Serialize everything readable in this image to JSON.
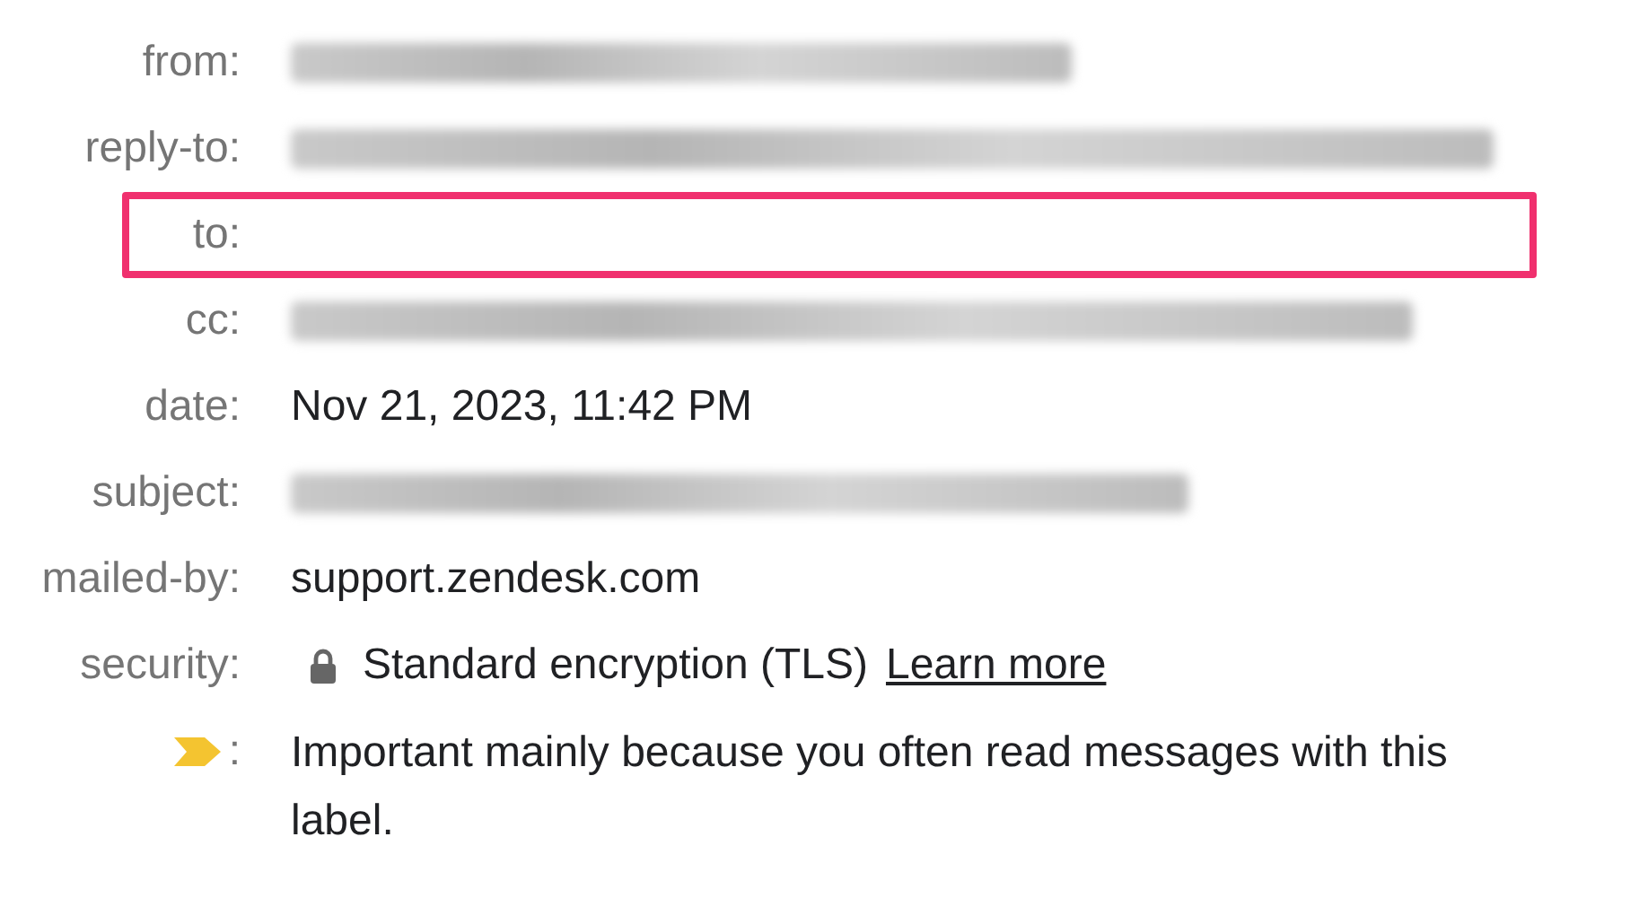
{
  "rows": [
    {
      "label": "from:",
      "kind": "blurred",
      "highlighted": false
    },
    {
      "label": "reply-to:",
      "kind": "blurred",
      "highlighted": false
    },
    {
      "label": "to:",
      "kind": "empty",
      "highlighted": true
    },
    {
      "label": "cc:",
      "kind": "blurred",
      "highlighted": false
    },
    {
      "label": "date:",
      "kind": "text",
      "value": "Nov 21, 2023, 11:42 PM",
      "highlighted": false
    },
    {
      "label": "subject:",
      "kind": "blurred",
      "highlighted": false
    },
    {
      "label": "mailed-by:",
      "kind": "text",
      "value": "support.zendesk.com",
      "highlighted": false
    },
    {
      "label": "security:",
      "kind": "security",
      "value": "Standard encryption (TLS)",
      "link": "Learn more",
      "highlighted": false
    },
    {
      "label": ":",
      "kind": "importance",
      "value": "Important mainly because you often read messages with this label.",
      "highlighted": false
    }
  ]
}
